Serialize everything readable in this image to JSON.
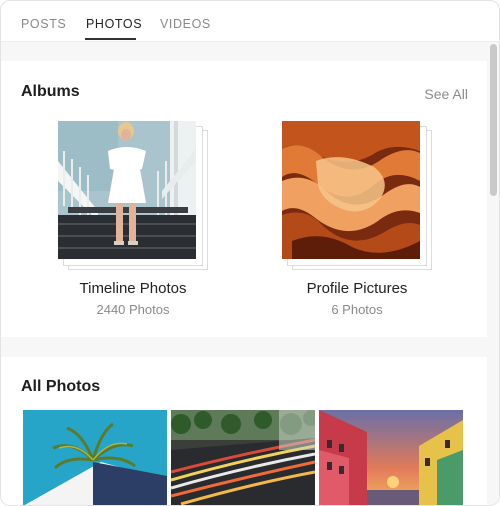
{
  "tabs": [
    {
      "label": "POSTS",
      "active": false
    },
    {
      "label": "PHOTOS",
      "active": true
    },
    {
      "label": "VIDEOS",
      "active": false
    }
  ],
  "albums_section": {
    "title": "Albums",
    "see_all": "See All",
    "albums": [
      {
        "name": "Timeline Photos",
        "count": "2440 Photos"
      },
      {
        "name": "Profile Pictures",
        "count": "6 Photos"
      }
    ]
  },
  "all_photos_section": {
    "title": "All Photos",
    "photos": [
      "palm-wall-photo",
      "city-traffic-photo",
      "canal-sunset-photo"
    ]
  },
  "colors": {
    "background": "#f7f7f7",
    "active_tab": "#222222",
    "inactive_tab": "#8a8a8a",
    "link": "#8d8d8d"
  }
}
